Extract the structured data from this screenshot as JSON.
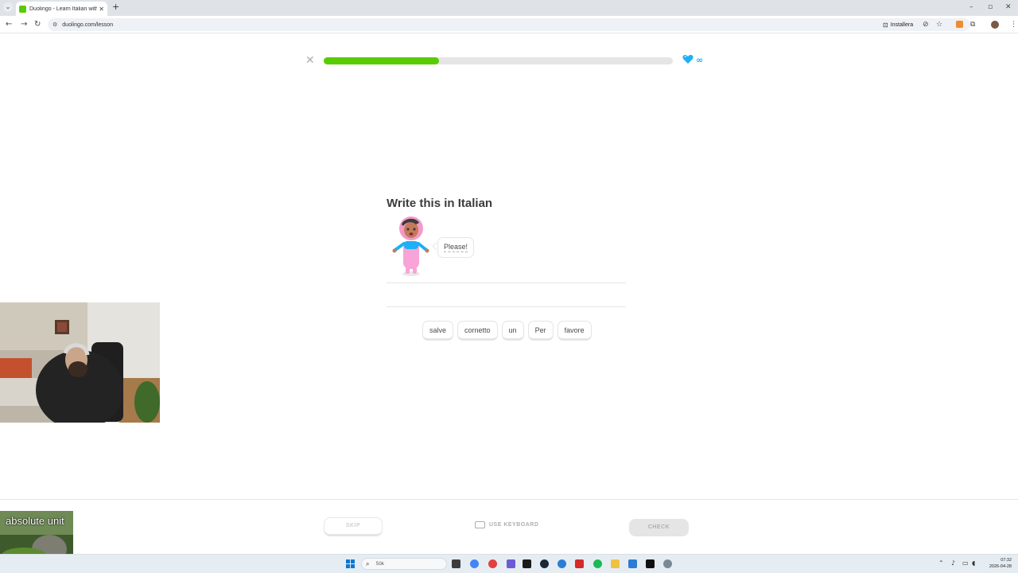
{
  "browser": {
    "tab_title": "Duolingo - Learn Italian with le",
    "tab_close": "✕",
    "new_tab": "+",
    "url": "duolingo.com/lesson",
    "install_label": "Installera"
  },
  "lesson": {
    "progress": 0.33,
    "hearts_display": "∞",
    "title": "Write this in Italian",
    "speech_text": "Please!",
    "word_bank": [
      "salve",
      "cornetto",
      "un",
      "Per",
      "favore"
    ]
  },
  "footer": {
    "skip_label": "SKIP",
    "keyboard_label": "USE KEYBOARD",
    "check_label": "CHECK"
  },
  "overlay": {
    "label": "absolute unit"
  },
  "taskbar": {
    "search_placeholder": "Sök",
    "time": "07:32",
    "date": "2026-04-28"
  },
  "colors": {
    "brand_green": "#58cc02",
    "heart_blue": "#1cb0f6",
    "border_gray": "#e5e5e5"
  },
  "icons": {
    "close": "close-icon",
    "heart": "heart-icon",
    "keyboard": "keyboard-icon",
    "search": "search-icon"
  }
}
